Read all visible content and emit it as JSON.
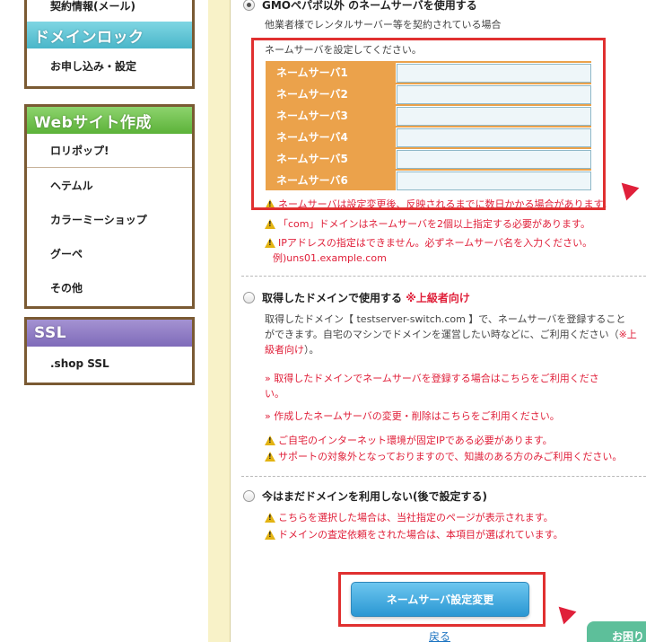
{
  "sidebar": {
    "box_a": {
      "items": [
        "契約情報(メール)"
      ]
    },
    "domain_lock": {
      "heading": "ドメインロック",
      "items": [
        "お申し込み・設定"
      ]
    },
    "website": {
      "heading": "Webサイト作成",
      "items": [
        "ロリポップ!",
        "ヘテムル",
        "カラーミーショップ",
        "グーペ",
        "その他"
      ]
    },
    "ssl": {
      "heading": "SSL",
      "items": [
        ".shop SSL"
      ]
    }
  },
  "main": {
    "option1": {
      "title": "GMOペパボ以外 のネームサーバを使用する",
      "desc": "他業者様でレンタルサーバー等を契約されている場合",
      "instruction": "ネームサーバを設定してください。",
      "ns_labels": [
        "ネームサーバ1",
        "ネームサーバ2",
        "ネームサーバ3",
        "ネームサーバ4",
        "ネームサーバ5",
        "ネームサーバ6"
      ],
      "ns_values": [
        "",
        "",
        "",
        "",
        "",
        ""
      ],
      "warnings": [
        "ネームサーバは設定変更後、反映されるまでに数日かかる場合があります。",
        "「com」ドメインはネームサーバを2個以上指定する必要があります。",
        "IPアドレスの指定はできません。必ずネームサーバ名を入力ください。"
      ],
      "example": "例)uns01.example.com"
    },
    "option2": {
      "title": "取得したドメインで使用する",
      "title_tag": "※上級者向け",
      "desc_line1": "取得したドメイン【 testserver-switch.com 】で、ネームサーバを登録すること",
      "desc_line2a": "ができます。自宅のマシンでドメインを運営したい時などに、ご利用ください（",
      "desc_tag": "※上",
      "desc_line3a": "級者向け",
      "desc_line3b": "）。",
      "link1": "» 取得したドメインでネームサーバを登録する場合はこちらをご利用くださ",
      "link1_cont": "い。",
      "link2": "» 作成したネームサーバの変更・削除はこちらをご利用ください。",
      "warnings": [
        "ご自宅のインターネット環境が固定IPである必要があります。",
        "サポートの対象外となっておりますので、知識のある方のみご利用ください。"
      ]
    },
    "option3": {
      "title": "今はまだドメインを利用しない(後で設定する)",
      "warnings": [
        "こちらを選択した場合は、当社指定のページが表示されます。",
        "ドメインの査定依頼をされた場合は、本項目が選ばれています。"
      ]
    },
    "submit_label": "ネームサーバ設定変更",
    "back_label": "戻る",
    "help_label": "お困り"
  },
  "colors": {
    "accent_red": "#e0203a",
    "ns_orange": "#eba24b",
    "button_blue": "#2a97d3",
    "link_blue": "#1b73c1"
  }
}
